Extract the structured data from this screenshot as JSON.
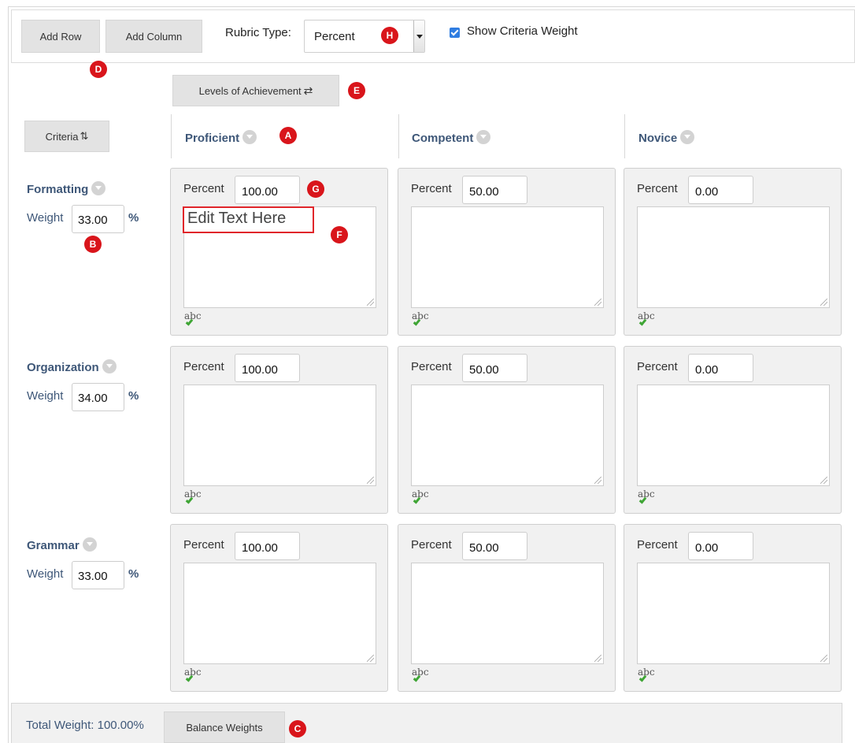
{
  "toolbar": {
    "add_row": "Add Row",
    "add_column": "Add Column",
    "rubric_type_label": "Rubric Type:",
    "rubric_type_value": "Percent",
    "show_criteria_weight": "Show Criteria Weight",
    "show_criteria_weight_checked": true
  },
  "levels_button": "Levels of Achievement",
  "criteria_button": "Criteria",
  "columns": [
    "Proficient",
    "Competent",
    "Novice"
  ],
  "percent_label": "Percent",
  "rows": [
    {
      "name": "Formatting",
      "weight_label": "Weight",
      "weight": "33.00",
      "percents": [
        "100.00",
        "50.00",
        "0.00"
      ]
    },
    {
      "name": "Organization",
      "weight_label": "Weight",
      "weight": "34.00",
      "percents": [
        "100.00",
        "50.00",
        "0.00"
      ]
    },
    {
      "name": "Grammar",
      "weight_label": "Weight",
      "weight": "33.00",
      "percents": [
        "100.00",
        "50.00",
        "0.00"
      ]
    }
  ],
  "weight_unit": "%",
  "edit_placeholder": "Edit Text Here",
  "spellcheck_label": "abc",
  "footer": {
    "total_weight": "Total Weight: 100.00%",
    "balance_weights": "Balance Weights"
  },
  "markers": {
    "a": "A",
    "b": "B",
    "c": "C",
    "d": "D",
    "e": "E",
    "f": "F",
    "g": "G",
    "h": "H"
  },
  "colors": {
    "header_text": "#3e5778",
    "marker": "#d9151b",
    "checkbox": "#2f7de1",
    "cell_bg": "#f1f1f1"
  }
}
